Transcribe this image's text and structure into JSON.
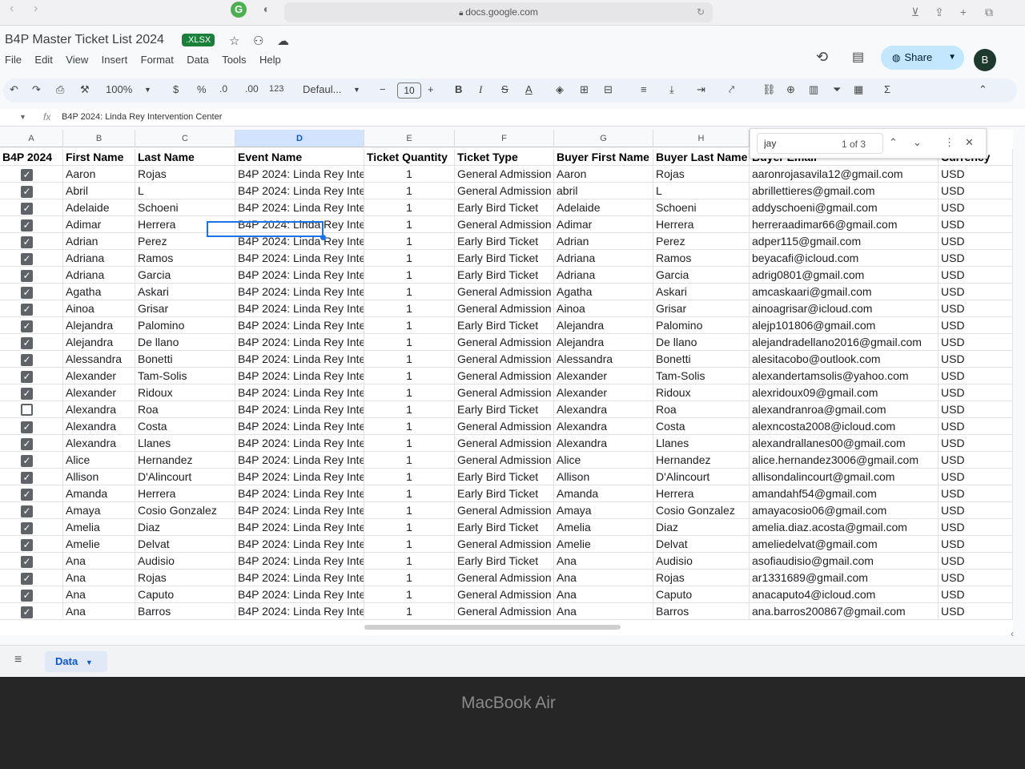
{
  "browser": {
    "url": "docs.google.com",
    "back": "‹",
    "forward": "›",
    "reload": "↻"
  },
  "doc": {
    "title": "B4P Master Ticket List 2024",
    "badge": ".XLSX"
  },
  "menu": [
    "File",
    "Edit",
    "View",
    "Insert",
    "Format",
    "Data",
    "Tools",
    "Help"
  ],
  "header_actions": {
    "share_label": "Share",
    "avatar_letter": "B"
  },
  "toolbar": {
    "zoom": "100%",
    "currency": "$",
    "percent": "%",
    "dec_decrease": ".0",
    "dec_increase": ".00",
    "number_format": "123",
    "font": "Defaul...",
    "minus": "−",
    "font_size": "10",
    "plus": "+",
    "bold": "B",
    "italic": "I",
    "strike": "S",
    "text_color": "A",
    "sum": "Σ"
  },
  "formula_bar": {
    "fx": "fx",
    "content": "B4P 2024: Linda Rey Intervention Center"
  },
  "columns": [
    "A",
    "B",
    "C",
    "D",
    "E",
    "F",
    "G",
    "H"
  ],
  "table": {
    "headers": [
      "B4P 2024",
      "First Name",
      "Last Name",
      "Event Name",
      "Ticket Quantity",
      "Ticket Type",
      "Buyer First Name",
      "Buyer Last Name",
      "Buyer Email",
      "Currency"
    ],
    "rows": [
      {
        "checked": true,
        "first": "Aaron",
        "last": "Rojas",
        "event": "B4P 2024: Linda Rey Inte",
        "qty": "1",
        "type": "General Admission",
        "bfirst": "Aaron",
        "blast": "Rojas",
        "email": "aaronrojasavila12@gmail.com",
        "cur": "USD"
      },
      {
        "checked": true,
        "first": "Abril",
        "last": "L",
        "event": "B4P 2024: Linda Rey Inte",
        "qty": "1",
        "type": "General Admission",
        "bfirst": "abril",
        "blast": "L",
        "email": "abrillettieres@gmail.com",
        "cur": "USD"
      },
      {
        "checked": true,
        "first": "Adelaide",
        "last": "Schoeni",
        "event": "B4P 2024: Linda Rey Inte",
        "qty": "1",
        "type": "Early Bird Ticket",
        "bfirst": "Adelaide",
        "blast": "Schoeni",
        "email": "addyschoeni@gmail.com",
        "cur": "USD"
      },
      {
        "checked": true,
        "first": "Adimar",
        "last": "Herrera",
        "event": "B4P 2024: Linda Rey Inte",
        "qty": "1",
        "type": "General Admission",
        "bfirst": "Adimar",
        "blast": "Herrera",
        "email": "herreraadimar66@gmail.com",
        "cur": "USD"
      },
      {
        "checked": true,
        "first": "Adrian",
        "last": "Perez",
        "event": "B4P 2024: Linda Rey Inte",
        "qty": "1",
        "type": "Early Bird Ticket",
        "bfirst": "Adrian",
        "blast": "Perez",
        "email": "adper115@gmail.com",
        "cur": "USD"
      },
      {
        "checked": true,
        "first": "Adriana",
        "last": "Ramos",
        "event": "B4P 2024: Linda Rey Inte",
        "qty": "1",
        "type": "Early Bird Ticket",
        "bfirst": "Adriana",
        "blast": "Ramos",
        "email": "beyacafi@icloud.com",
        "cur": "USD"
      },
      {
        "checked": true,
        "first": "Adriana",
        "last": "Garcia",
        "event": "B4P 2024: Linda Rey Inte",
        "qty": "1",
        "type": "Early Bird Ticket",
        "bfirst": "Adriana",
        "blast": "Garcia",
        "email": "adrig0801@gmail.com",
        "cur": "USD"
      },
      {
        "checked": true,
        "first": "Agatha",
        "last": "Askari",
        "event": "B4P 2024: Linda Rey Inte",
        "qty": "1",
        "type": "General Admission",
        "bfirst": "Agatha",
        "blast": "Askari",
        "email": "amcaskaari@gmail.com",
        "cur": "USD"
      },
      {
        "checked": true,
        "first": "Ainoa",
        "last": "Grisar",
        "event": "B4P 2024: Linda Rey Inte",
        "qty": "1",
        "type": "General Admission",
        "bfirst": "Ainoa",
        "blast": "Grisar",
        "email": "ainoagrisar@icloud.com",
        "cur": "USD"
      },
      {
        "checked": true,
        "first": "Alejandra",
        "last": "Palomino",
        "event": "B4P 2024: Linda Rey Inte",
        "qty": "1",
        "type": "Early Bird Ticket",
        "bfirst": "Alejandra",
        "blast": "Palomino",
        "email": "alejp101806@gmail.com",
        "cur": "USD"
      },
      {
        "checked": true,
        "first": "Alejandra",
        "last": "De llano",
        "event": "B4P 2024: Linda Rey Inte",
        "qty": "1",
        "type": "General Admission",
        "bfirst": "Alejandra",
        "blast": "De llano",
        "email": "alejandradellano2016@gmail.com",
        "cur": "USD"
      },
      {
        "checked": true,
        "first": "Alessandra",
        "last": "Bonetti",
        "event": "B4P 2024: Linda Rey Inte",
        "qty": "1",
        "type": "General Admission",
        "bfirst": "Alessandra",
        "blast": "Bonetti",
        "email": "alesitacobo@outlook.com",
        "cur": "USD"
      },
      {
        "checked": true,
        "first": "Alexander",
        "last": "Tam-Solis",
        "event": "B4P 2024: Linda Rey Inte",
        "qty": "1",
        "type": "General Admission",
        "bfirst": "Alexander",
        "blast": "Tam-Solis",
        "email": "alexandertamsolis@yahoo.com",
        "cur": "USD"
      },
      {
        "checked": true,
        "first": "Alexander",
        "last": "Ridoux",
        "event": "B4P 2024: Linda Rey Inte",
        "qty": "1",
        "type": "General Admission",
        "bfirst": "Alexander",
        "blast": "Ridoux",
        "email": "alexridoux09@gmail.com",
        "cur": "USD"
      },
      {
        "checked": false,
        "first": "Alexandra",
        "last": "Roa",
        "event": "B4P 2024: Linda Rey Inte",
        "qty": "1",
        "type": "Early Bird Ticket",
        "bfirst": "Alexandra",
        "blast": "Roa",
        "email": "alexandranroa@gmail.com",
        "cur": "USD"
      },
      {
        "checked": true,
        "first": "Alexandra",
        "last": "Costa",
        "event": "B4P 2024: Linda Rey Inte",
        "qty": "1",
        "type": "General Admission",
        "bfirst": "Alexandra",
        "blast": "Costa",
        "email": "alexncosta2008@icloud.com",
        "cur": "USD"
      },
      {
        "checked": true,
        "first": "Alexandra",
        "last": "Llanes",
        "event": "B4P 2024: Linda Rey Inte",
        "qty": "1",
        "type": "General Admission",
        "bfirst": "Alexandra",
        "blast": "Llanes",
        "email": "alexandrallanes00@gmail.com",
        "cur": "USD"
      },
      {
        "checked": true,
        "first": "Alice",
        "last": "Hernandez",
        "event": "B4P 2024: Linda Rey Inte",
        "qty": "1",
        "type": "General Admission",
        "bfirst": "Alice",
        "blast": "Hernandez",
        "email": "alice.hernandez3006@gmail.com",
        "cur": "USD"
      },
      {
        "checked": true,
        "first": "Allison",
        "last": "D'Alincourt",
        "event": "B4P 2024: Linda Rey Inte",
        "qty": "1",
        "type": "Early Bird Ticket",
        "bfirst": "Allison",
        "blast": "D'Alincourt",
        "email": "allisondalincourt@gmail.com",
        "cur": "USD"
      },
      {
        "checked": true,
        "first": "Amanda",
        "last": "Herrera",
        "event": "B4P 2024: Linda Rey Inte",
        "qty": "1",
        "type": "Early Bird Ticket",
        "bfirst": "Amanda",
        "blast": "Herrera",
        "email": "amandahf54@gmail.com",
        "cur": "USD"
      },
      {
        "checked": true,
        "first": "Amaya",
        "last": "Cosio Gonzalez",
        "event": "B4P 2024: Linda Rey Inte",
        "qty": "1",
        "type": "General Admission",
        "bfirst": "Amaya",
        "blast": "Cosio Gonzalez",
        "email": "amayacosio06@gmail.com",
        "cur": "USD"
      },
      {
        "checked": true,
        "first": "Amelia",
        "last": "Diaz",
        "event": "B4P 2024: Linda Rey Inte",
        "qty": "1",
        "type": "Early Bird Ticket",
        "bfirst": "Amelia",
        "blast": "Diaz",
        "email": "amelia.diaz.acosta@gmail.com",
        "cur": "USD"
      },
      {
        "checked": true,
        "first": "Amelie",
        "last": "Delvat",
        "event": "B4P 2024: Linda Rey Inte",
        "qty": "1",
        "type": "General Admission",
        "bfirst": "Amelie",
        "blast": "Delvat",
        "email": "ameliedelvat@gmail.com",
        "cur": "USD"
      },
      {
        "checked": true,
        "first": "Ana",
        "last": "Audisio",
        "event": "B4P 2024: Linda Rey Inte",
        "qty": "1",
        "type": "Early Bird Ticket",
        "bfirst": "Ana",
        "blast": "Audisio",
        "email": "asofiaudisio@gmail.com",
        "cur": "USD"
      },
      {
        "checked": true,
        "first": "Ana",
        "last": "Rojas",
        "event": "B4P 2024: Linda Rey Inte",
        "qty": "1",
        "type": "General Admission",
        "bfirst": "Ana",
        "blast": "Rojas",
        "email": "ar1331689@gmail.com",
        "cur": "USD"
      },
      {
        "checked": true,
        "first": "Ana",
        "last": "Caputo",
        "event": "B4P 2024: Linda Rey Inte",
        "qty": "1",
        "type": "General Admission",
        "bfirst": "Ana",
        "blast": "Caputo",
        "email": "anacaputo4@icloud.com",
        "cur": "USD"
      },
      {
        "checked": true,
        "first": "Ana",
        "last": "Barros",
        "event": "B4P 2024: Linda Rey Inte",
        "qty": "1",
        "type": "General Admission",
        "bfirst": "Ana",
        "blast": "Barros",
        "email": "ana.barros200867@gmail.com",
        "cur": "USD"
      }
    ]
  },
  "find": {
    "query": "jay",
    "count": "1 of 3"
  },
  "sheet_tab": "Data",
  "laptop_label": "MacBook Air",
  "colors": {
    "accent": "#0b57d0",
    "share_bg": "#c2e7ff",
    "xlsx_badge": "#188038"
  }
}
